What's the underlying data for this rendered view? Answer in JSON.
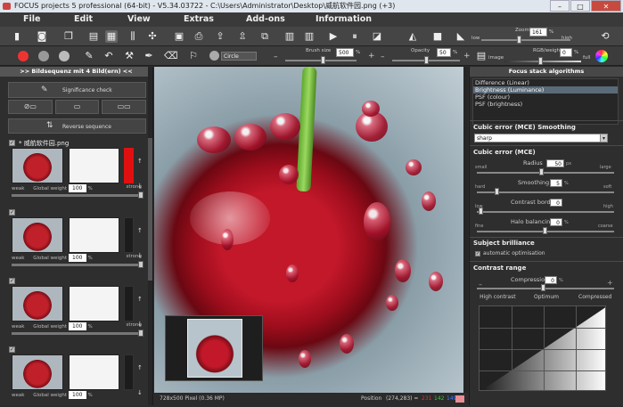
{
  "window": {
    "title": "FOCUS projects 5 professional (64-bit) - V5.34.03722 - C:\\Users\\Administrator\\Desktop\\威航软件园.png (+3)",
    "minimize": "–",
    "maximize": "□",
    "close": "✕"
  },
  "menu": [
    "File",
    "Edit",
    "View",
    "Extras",
    "Add-ons",
    "Information"
  ],
  "toolbar": {
    "zoom_label": "Zoom",
    "zoom_value": "161",
    "zoom_unit": "%",
    "zoom_low": "low",
    "zoom_high": "high",
    "brush_label": "Brush size",
    "brush_value": "500",
    "brush_unit": "%",
    "opacity_label": "Opacity",
    "opacity_value": "50",
    "opacity_unit": "%",
    "shape_value": "Circle",
    "rgb_label": "RGB/weighting",
    "rgb_value": "0",
    "rgb_unit": "%",
    "image_label": "image",
    "full_label": "full"
  },
  "left_panel": {
    "header": ">> Bildsequenz mit 4 Bild(ern) <<",
    "significance_label": "Significance check",
    "reverse_label": "Reverse sequence",
    "frames": [
      {
        "name": "威航软件园.png",
        "weight": "100",
        "unit": "%",
        "weak": "weak",
        "strong": "strong",
        "label": "Global weight",
        "checked": "✓"
      },
      {
        "name": "",
        "weight": "100",
        "unit": "%",
        "weak": "weak",
        "strong": "strong",
        "label": "Global weight",
        "checked": "✓"
      },
      {
        "name": "",
        "weight": "100",
        "unit": "%",
        "weak": "weak",
        "strong": "strong",
        "label": "Global weight",
        "checked": "✓"
      },
      {
        "name": "",
        "weight": "100",
        "unit": "%",
        "weak": "weak",
        "strong": "strong",
        "label": "Global weight",
        "checked": "✓"
      }
    ]
  },
  "status": {
    "dimensions": "728x500 Pixel (0.36 MP)",
    "position_label": "Position",
    "position_value": "(274,283) =",
    "r": "231",
    "g": "142",
    "b": "149",
    "r_color": "#e03030",
    "g_color": "#40c040",
    "b_color": "#4080ff",
    "swatch_color": "#e88e95"
  },
  "right_panel": {
    "header": "Focus stack algorithms",
    "algorithms": [
      "Difference (Linear)",
      "Brightness (Luminance)",
      "PSF (colour)",
      "PSF (brightness)"
    ],
    "selected_index": 1,
    "smoothing_title": "Cubic error (MCE) Smoothing",
    "smoothing_value": "sharp",
    "mce_title": "Cubic error (MCE)",
    "radius_label": "Radius",
    "radius_value": "50",
    "radius_unit": "px",
    "small": "small",
    "large": "large",
    "smoothing_label": "Smoothing",
    "smoothing_num": "5",
    "smoothing_unit": "%",
    "hard": "hard",
    "soft": "soft",
    "contrast_label": "Contrast border",
    "contrast_value": "0",
    "low": "low",
    "high": "high",
    "halo_label": "Halo balancing",
    "halo_value": "0",
    "halo_unit": "%",
    "fine": "fine",
    "coarse": "coarse",
    "brilliance_title": "Subject brilliance",
    "auto_opt": "automatic optimisation",
    "range_title": "Contrast range",
    "compression_label": "Compression",
    "compression_value": "0",
    "compression_unit": "%",
    "minus": "–",
    "plus": "+",
    "tab_high": "High contrast",
    "tab_optimum": "Optimum",
    "tab_compressed": "Compressed"
  }
}
